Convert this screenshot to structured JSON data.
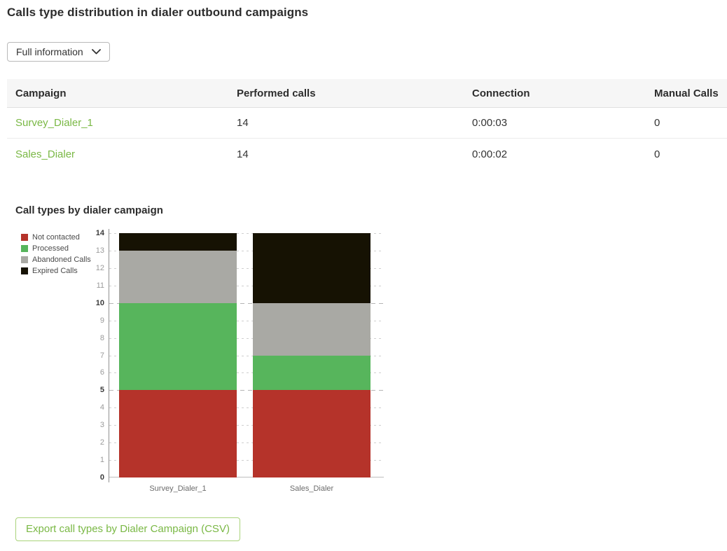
{
  "page_title": "Calls type distribution in dialer outbound campaigns",
  "filter_dropdown": {
    "value": "Full information"
  },
  "table": {
    "headers": [
      "Campaign",
      "Performed calls",
      "Connection",
      "Manual Calls"
    ],
    "rows": [
      {
        "campaign": "Survey_Dialer_1",
        "performed_calls": "14",
        "connection": "0:00:03",
        "manual_calls": "0"
      },
      {
        "campaign": "Sales_Dialer",
        "performed_calls": "14",
        "connection": "0:00:02",
        "manual_calls": "0"
      }
    ]
  },
  "chart_data": {
    "type": "bar",
    "stacked": true,
    "title": "Call types by dialer campaign",
    "categories": [
      "Survey_Dialer_1",
      "Sales_Dialer"
    ],
    "series": [
      {
        "name": "Not contacted",
        "color": "#b5332a",
        "values": [
          5,
          5
        ]
      },
      {
        "name": "Processed",
        "color": "#57b55c",
        "values": [
          5,
          2
        ]
      },
      {
        "name": "Abandoned Calls",
        "color": "#a9a9a4",
        "values": [
          3,
          3
        ]
      },
      {
        "name": "Expired Calls",
        "color": "#161203",
        "values": [
          1,
          4
        ]
      }
    ],
    "ylim": [
      0,
      14
    ],
    "y_tick_step": 1,
    "major_tick_values": [
      0,
      5,
      10,
      14
    ],
    "grid": true,
    "legend_position": "left"
  },
  "export_button": {
    "label": "Export call types by Dialer Campaign (CSV)"
  },
  "colors": {
    "accent_green": "#7ab845",
    "button_border_green": "#a9d37a",
    "table_header_bg": "#f6f6f6"
  }
}
